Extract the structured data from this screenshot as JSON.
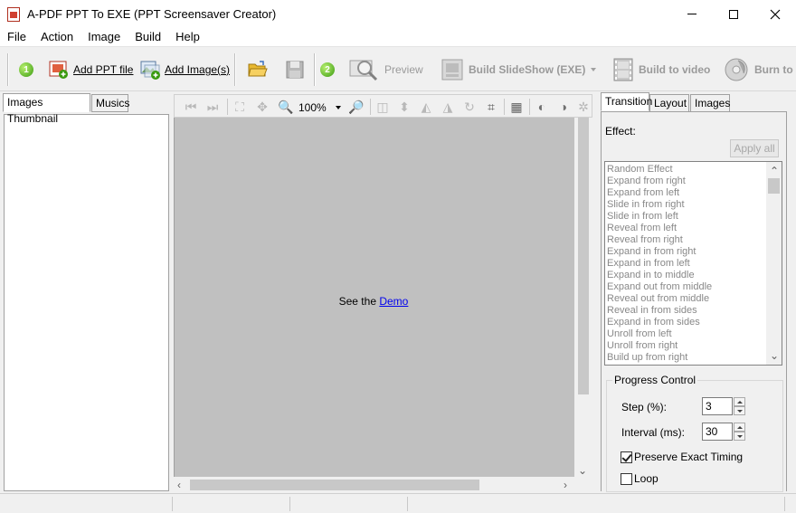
{
  "window": {
    "title": "A-PDF PPT To EXE (PPT Screensaver Creator)"
  },
  "menu": [
    "File",
    "Action",
    "Image",
    "Build",
    "Help"
  ],
  "toolbar": {
    "step1_badge": "1",
    "add_ppt_label": "Add PPT file",
    "add_images_label": "Add Image(s)",
    "step2_badge": "2",
    "preview_label": "Preview",
    "build_slideshow_label": "Build SlideShow (EXE)",
    "build_video_label": "Build to video",
    "burn_label": "Burn to"
  },
  "left_panel": {
    "tabs": [
      "Images Thumbnail",
      "Musics"
    ],
    "active_tab": 0
  },
  "center": {
    "zoom": "100%",
    "see_the": "See the",
    "demo_link": "Demo"
  },
  "right_panel": {
    "tabs": [
      "Transition",
      "Layout",
      "Images"
    ],
    "active_tab": 0,
    "effect_label": "Effect:",
    "apply_all_label": "Apply all",
    "effects": [
      "Random Effect",
      "Expand from right",
      "Expand from left",
      "Slide in from right",
      "Slide in from left",
      "Reveal from left",
      "Reveal from right",
      "Expand in from right",
      "Expand in from left",
      "Expand in to middle",
      "Expand out from middle",
      "Reveal out from middle",
      "Reveal in from sides",
      "Expand in from sides",
      "Unroll from left",
      "Unroll from right",
      "Build up from right"
    ],
    "progress": {
      "title": "Progress Control",
      "step_label": "Step (%):",
      "step_value": "3",
      "interval_label": "Interval (ms):",
      "interval_value": "30",
      "preserve_label": "Preserve Exact Timing",
      "preserve_checked": true,
      "loop_label": "Loop",
      "loop_checked": false
    }
  }
}
